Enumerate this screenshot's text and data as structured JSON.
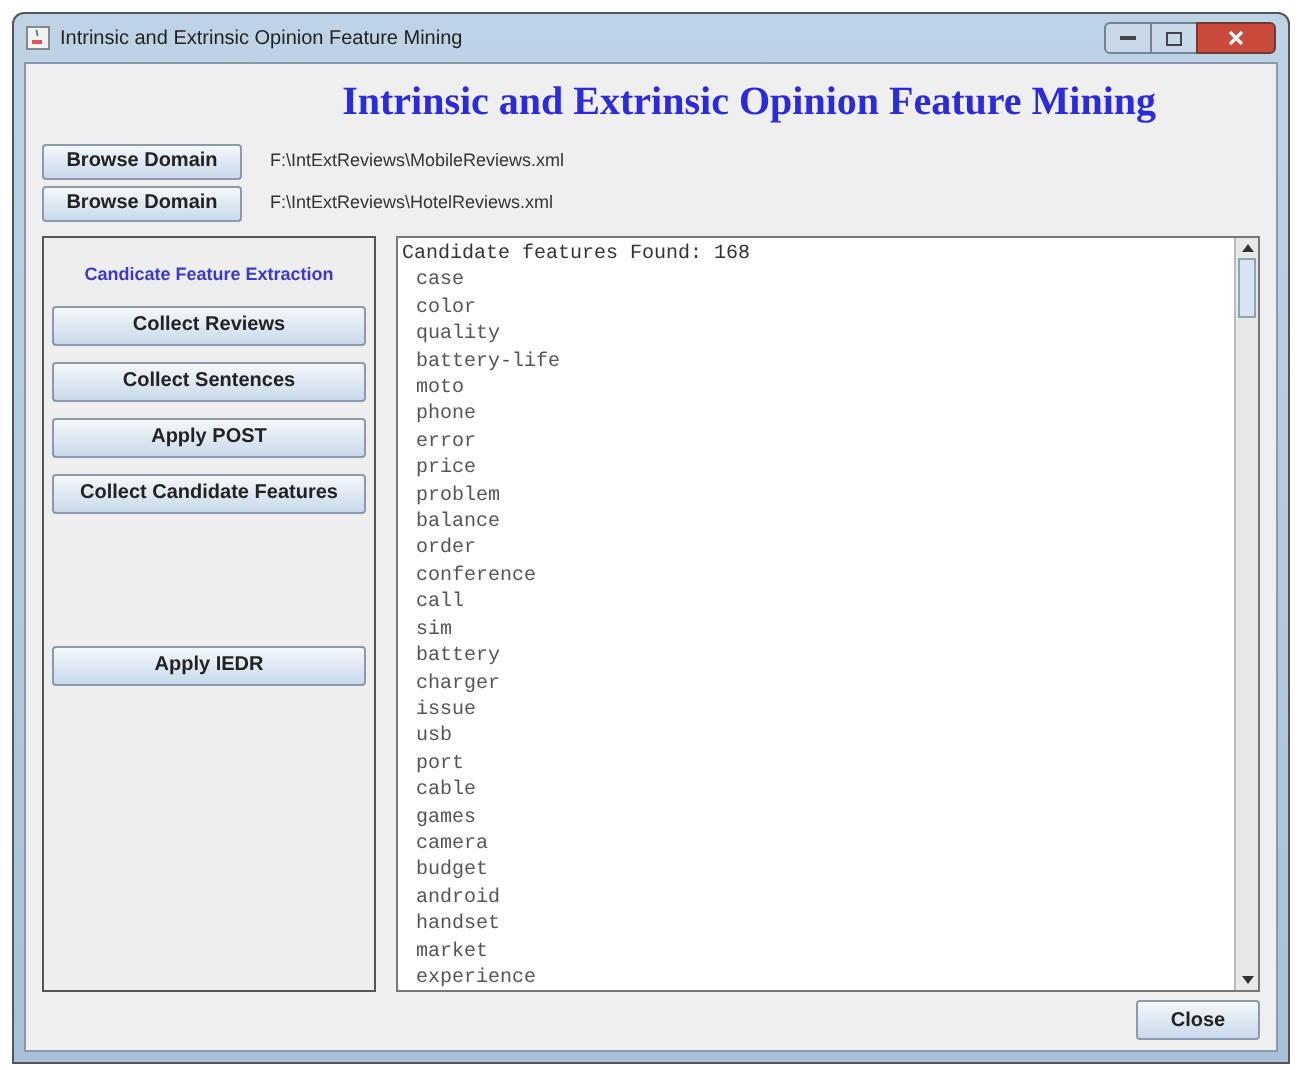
{
  "window": {
    "title": "Intrinsic and Extrinsic Opinion Feature Mining"
  },
  "heading": "Intrinsic and Extrinsic Opinion Feature Mining",
  "domains": [
    {
      "button": "Browse Domain",
      "path": "F:\\IntExtReviews\\MobileReviews.xml"
    },
    {
      "button": "Browse Domain",
      "path": "F:\\IntExtReviews\\HotelReviews.xml"
    }
  ],
  "side_panel": {
    "title": "Candicate Feature Extraction",
    "buttons": [
      {
        "label": "Collect Reviews",
        "kind": "step"
      },
      {
        "label": "Collect Sentences",
        "kind": "step"
      },
      {
        "label": "Apply POST",
        "kind": "step"
      },
      {
        "label": "Collect Candidate Features",
        "kind": "step"
      },
      {
        "label": "Apply IEDR",
        "kind": "final"
      }
    ]
  },
  "output": {
    "header": "Candidate features Found: 168",
    "lines": [
      "case",
      "color",
      "quality",
      "battery-life",
      "moto",
      "phone",
      "error",
      "price",
      "problem",
      "balance",
      "order",
      "conference",
      "call",
      "sim",
      "battery",
      "charger",
      "issue",
      "usb",
      "port",
      "cable",
      "games",
      "camera",
      "budget",
      "android",
      "handset",
      "market",
      "experience"
    ]
  },
  "close_button": "Close"
}
